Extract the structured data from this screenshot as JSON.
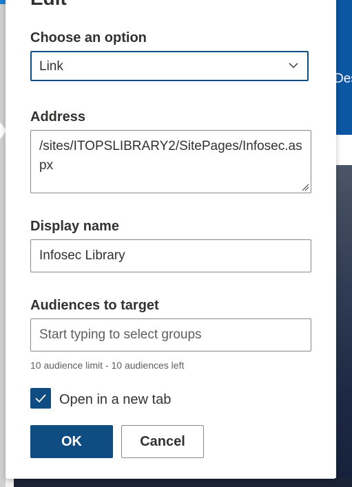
{
  "panel": {
    "title": "Edit"
  },
  "option": {
    "label": "Choose an option",
    "selected": "Link"
  },
  "address": {
    "label": "Address",
    "value": "/sites/ITOPSLIBRARY2/SitePages/Infosec.aspx"
  },
  "display_name": {
    "label": "Display name",
    "value": "Infosec Library"
  },
  "audiences": {
    "label": "Audiences to target",
    "placeholder": "Start typing to select groups",
    "hint": "10 audience limit - 10 audiences left"
  },
  "new_tab": {
    "label": "Open in a new tab",
    "checked": true
  },
  "buttons": {
    "ok": "OK",
    "cancel": "Cancel"
  },
  "background": {
    "partial_text": "Des"
  },
  "colors": {
    "accent": "#0f4c81",
    "header_blue": "#0b57a4"
  }
}
